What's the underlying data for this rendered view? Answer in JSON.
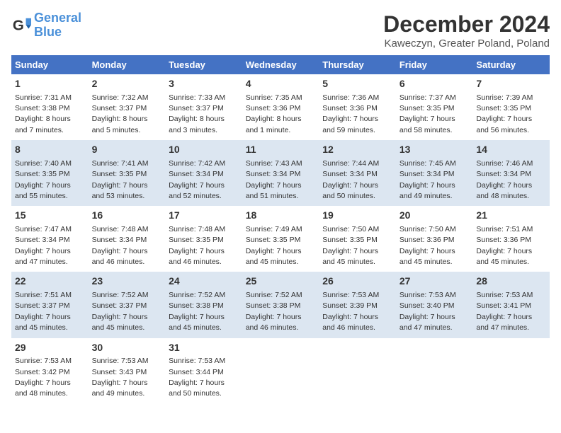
{
  "header": {
    "logo_line1": "General",
    "logo_line2": "Blue",
    "title": "December 2024",
    "subtitle": "Kaweczyn, Greater Poland, Poland"
  },
  "days_of_week": [
    "Sunday",
    "Monday",
    "Tuesday",
    "Wednesday",
    "Thursday",
    "Friday",
    "Saturday"
  ],
  "weeks": [
    [
      {
        "day": "1",
        "info": "Sunrise: 7:31 AM\nSunset: 3:38 PM\nDaylight: 8 hours\nand 7 minutes."
      },
      {
        "day": "2",
        "info": "Sunrise: 7:32 AM\nSunset: 3:37 PM\nDaylight: 8 hours\nand 5 minutes."
      },
      {
        "day": "3",
        "info": "Sunrise: 7:33 AM\nSunset: 3:37 PM\nDaylight: 8 hours\nand 3 minutes."
      },
      {
        "day": "4",
        "info": "Sunrise: 7:35 AM\nSunset: 3:36 PM\nDaylight: 8 hours\nand 1 minute."
      },
      {
        "day": "5",
        "info": "Sunrise: 7:36 AM\nSunset: 3:36 PM\nDaylight: 7 hours\nand 59 minutes."
      },
      {
        "day": "6",
        "info": "Sunrise: 7:37 AM\nSunset: 3:35 PM\nDaylight: 7 hours\nand 58 minutes."
      },
      {
        "day": "7",
        "info": "Sunrise: 7:39 AM\nSunset: 3:35 PM\nDaylight: 7 hours\nand 56 minutes."
      }
    ],
    [
      {
        "day": "8",
        "info": "Sunrise: 7:40 AM\nSunset: 3:35 PM\nDaylight: 7 hours\nand 55 minutes."
      },
      {
        "day": "9",
        "info": "Sunrise: 7:41 AM\nSunset: 3:35 PM\nDaylight: 7 hours\nand 53 minutes."
      },
      {
        "day": "10",
        "info": "Sunrise: 7:42 AM\nSunset: 3:34 PM\nDaylight: 7 hours\nand 52 minutes."
      },
      {
        "day": "11",
        "info": "Sunrise: 7:43 AM\nSunset: 3:34 PM\nDaylight: 7 hours\nand 51 minutes."
      },
      {
        "day": "12",
        "info": "Sunrise: 7:44 AM\nSunset: 3:34 PM\nDaylight: 7 hours\nand 50 minutes."
      },
      {
        "day": "13",
        "info": "Sunrise: 7:45 AM\nSunset: 3:34 PM\nDaylight: 7 hours\nand 49 minutes."
      },
      {
        "day": "14",
        "info": "Sunrise: 7:46 AM\nSunset: 3:34 PM\nDaylight: 7 hours\nand 48 minutes."
      }
    ],
    [
      {
        "day": "15",
        "info": "Sunrise: 7:47 AM\nSunset: 3:34 PM\nDaylight: 7 hours\nand 47 minutes."
      },
      {
        "day": "16",
        "info": "Sunrise: 7:48 AM\nSunset: 3:34 PM\nDaylight: 7 hours\nand 46 minutes."
      },
      {
        "day": "17",
        "info": "Sunrise: 7:48 AM\nSunset: 3:35 PM\nDaylight: 7 hours\nand 46 minutes."
      },
      {
        "day": "18",
        "info": "Sunrise: 7:49 AM\nSunset: 3:35 PM\nDaylight: 7 hours\nand 45 minutes."
      },
      {
        "day": "19",
        "info": "Sunrise: 7:50 AM\nSunset: 3:35 PM\nDaylight: 7 hours\nand 45 minutes."
      },
      {
        "day": "20",
        "info": "Sunrise: 7:50 AM\nSunset: 3:36 PM\nDaylight: 7 hours\nand 45 minutes."
      },
      {
        "day": "21",
        "info": "Sunrise: 7:51 AM\nSunset: 3:36 PM\nDaylight: 7 hours\nand 45 minutes."
      }
    ],
    [
      {
        "day": "22",
        "info": "Sunrise: 7:51 AM\nSunset: 3:37 PM\nDaylight: 7 hours\nand 45 minutes."
      },
      {
        "day": "23",
        "info": "Sunrise: 7:52 AM\nSunset: 3:37 PM\nDaylight: 7 hours\nand 45 minutes."
      },
      {
        "day": "24",
        "info": "Sunrise: 7:52 AM\nSunset: 3:38 PM\nDaylight: 7 hours\nand 45 minutes."
      },
      {
        "day": "25",
        "info": "Sunrise: 7:52 AM\nSunset: 3:38 PM\nDaylight: 7 hours\nand 46 minutes."
      },
      {
        "day": "26",
        "info": "Sunrise: 7:53 AM\nSunset: 3:39 PM\nDaylight: 7 hours\nand 46 minutes."
      },
      {
        "day": "27",
        "info": "Sunrise: 7:53 AM\nSunset: 3:40 PM\nDaylight: 7 hours\nand 47 minutes."
      },
      {
        "day": "28",
        "info": "Sunrise: 7:53 AM\nSunset: 3:41 PM\nDaylight: 7 hours\nand 47 minutes."
      }
    ],
    [
      {
        "day": "29",
        "info": "Sunrise: 7:53 AM\nSunset: 3:42 PM\nDaylight: 7 hours\nand 48 minutes."
      },
      {
        "day": "30",
        "info": "Sunrise: 7:53 AM\nSunset: 3:43 PM\nDaylight: 7 hours\nand 49 minutes."
      },
      {
        "day": "31",
        "info": "Sunrise: 7:53 AM\nSunset: 3:44 PM\nDaylight: 7 hours\nand 50 minutes."
      },
      {
        "day": "",
        "info": ""
      },
      {
        "day": "",
        "info": ""
      },
      {
        "day": "",
        "info": ""
      },
      {
        "day": "",
        "info": ""
      }
    ]
  ]
}
